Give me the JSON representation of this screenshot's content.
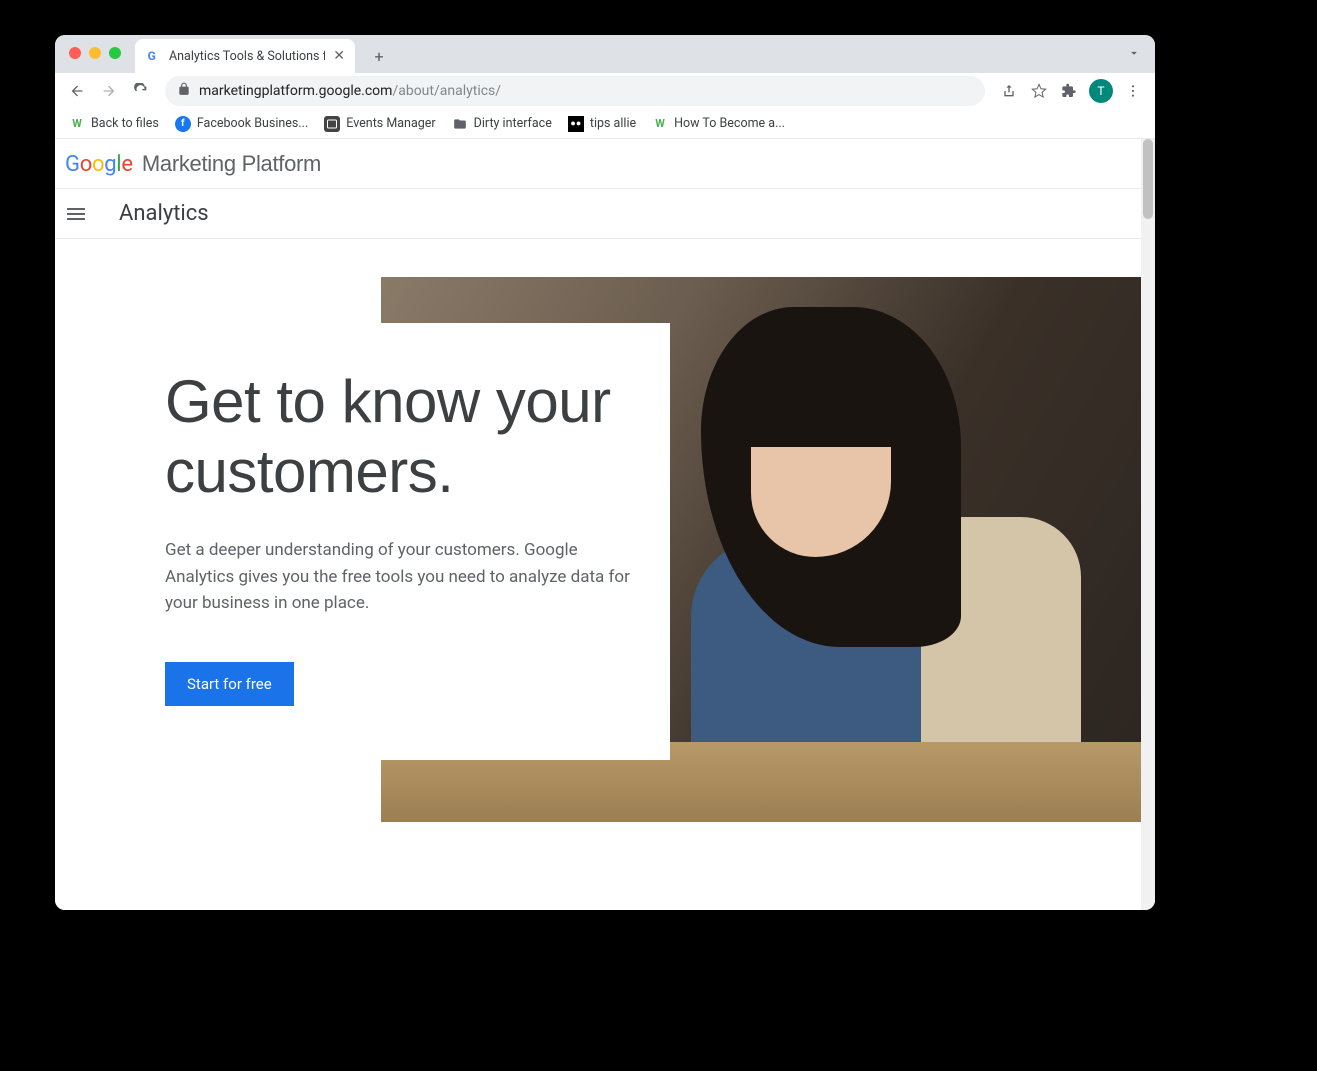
{
  "browser": {
    "tab_title": "Analytics Tools & Solutions for",
    "url_host": "marketingplatform.google.com",
    "url_path": "/about/analytics/",
    "avatar_initial": "T"
  },
  "bookmarks": [
    {
      "icon": "w",
      "label": "Back to files"
    },
    {
      "icon": "fb",
      "label": "Facebook Busines..."
    },
    {
      "icon": "events",
      "label": "Events Manager"
    },
    {
      "icon": "folder",
      "label": "Dirty interface"
    },
    {
      "icon": "medium",
      "label": "tips allie"
    },
    {
      "icon": "w",
      "label": "How To Become a..."
    }
  ],
  "gmp": {
    "brand_suffix": "Marketing Platform",
    "section": "Analytics"
  },
  "hero": {
    "headline": "Get to know your customers.",
    "subhead": "Get a deeper understanding of your customers. Google Analytics gives you the free tools you need to analyze data for your business in one place.",
    "cta": "Start for free"
  }
}
